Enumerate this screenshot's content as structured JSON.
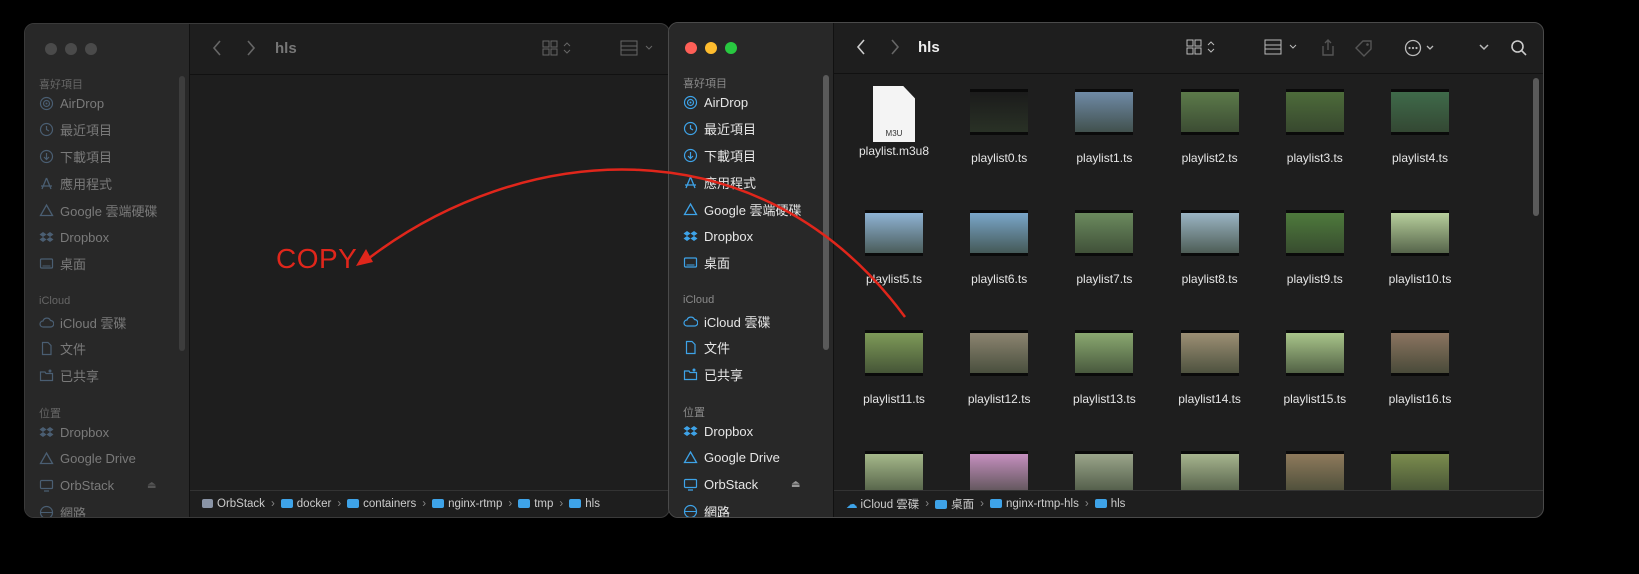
{
  "left_window": {
    "title": "hls",
    "sidebar": {
      "favorites_header": "喜好項目",
      "favorites": [
        {
          "label": "AirDrop",
          "icon": "airdrop-icon"
        },
        {
          "label": "最近項目",
          "icon": "clock-icon"
        },
        {
          "label": "下載項目",
          "icon": "download-icon"
        },
        {
          "label": "應用程式",
          "icon": "apps-icon"
        },
        {
          "label": "Google 雲端硬碟",
          "icon": "drive-icon"
        },
        {
          "label": "Dropbox",
          "icon": "dropbox-icon"
        },
        {
          "label": "桌面",
          "icon": "desktop-icon"
        }
      ],
      "icloud_header": "iCloud",
      "icloud": [
        {
          "label": "iCloud 雲碟",
          "icon": "cloud-icon"
        },
        {
          "label": "文件",
          "icon": "document-icon"
        },
        {
          "label": "已共享",
          "icon": "shared-folder-icon"
        }
      ],
      "locations_header": "位置",
      "locations": [
        {
          "label": "Dropbox",
          "icon": "dropbox-icon"
        },
        {
          "label": "Google Drive",
          "icon": "drive-icon"
        },
        {
          "label": "OrbStack",
          "icon": "display-icon"
        },
        {
          "label": "網路",
          "icon": "network-icon"
        }
      ]
    },
    "path": [
      "OrbStack",
      "docker",
      "containers",
      "nginx-rtmp",
      "tmp",
      "hls"
    ]
  },
  "right_window": {
    "title": "hls",
    "sidebar": {
      "favorites_header": "喜好項目",
      "favorites": [
        {
          "label": "AirDrop",
          "icon": "airdrop-icon"
        },
        {
          "label": "最近項目",
          "icon": "clock-icon"
        },
        {
          "label": "下載項目",
          "icon": "download-icon"
        },
        {
          "label": "應用程式",
          "icon": "apps-icon"
        },
        {
          "label": "Google 雲端硬碟",
          "icon": "drive-icon"
        },
        {
          "label": "Dropbox",
          "icon": "dropbox-icon"
        },
        {
          "label": "桌面",
          "icon": "desktop-icon"
        }
      ],
      "icloud_header": "iCloud",
      "icloud": [
        {
          "label": "iCloud 雲碟",
          "icon": "cloud-icon"
        },
        {
          "label": "文件",
          "icon": "document-icon"
        },
        {
          "label": "已共享",
          "icon": "shared-folder-icon"
        }
      ],
      "locations_header": "位置",
      "locations": [
        {
          "label": "Dropbox",
          "icon": "dropbox-icon"
        },
        {
          "label": "Google Drive",
          "icon": "drive-icon"
        },
        {
          "label": "OrbStack",
          "icon": "display-icon"
        },
        {
          "label": "網路",
          "icon": "network-icon"
        }
      ]
    },
    "files": [
      {
        "name": "playlist.m3u8",
        "kind": "m3u",
        "badge": "M3U"
      },
      {
        "name": "playlist0.ts",
        "kind": "video",
        "color": "#1b1b1b"
      },
      {
        "name": "playlist1.ts",
        "kind": "video",
        "color": "#6f8aa6"
      },
      {
        "name": "playlist2.ts",
        "kind": "video",
        "color": "#5c7a4a"
      },
      {
        "name": "playlist3.ts",
        "kind": "video",
        "color": "#4d6b3a"
      },
      {
        "name": "playlist4.ts",
        "kind": "video",
        "color": "#3f6a4a"
      },
      {
        "name": "playlist5.ts",
        "kind": "video",
        "color": "#8fb3d4"
      },
      {
        "name": "playlist6.ts",
        "kind": "video",
        "color": "#7aa6c9"
      },
      {
        "name": "playlist7.ts",
        "kind": "video",
        "color": "#6b8a5e"
      },
      {
        "name": "playlist8.ts",
        "kind": "video",
        "color": "#9bb5c4"
      },
      {
        "name": "playlist9.ts",
        "kind": "video",
        "color": "#4e7a3c"
      },
      {
        "name": "playlist10.ts",
        "kind": "video",
        "color": "#b7cf9c"
      },
      {
        "name": "playlist11.ts",
        "kind": "video",
        "color": "#7e9a58"
      },
      {
        "name": "playlist12.ts",
        "kind": "video",
        "color": "#8c8470"
      },
      {
        "name": "playlist13.ts",
        "kind": "video",
        "color": "#8aa870"
      },
      {
        "name": "playlist14.ts",
        "kind": "video",
        "color": "#9c8f74"
      },
      {
        "name": "playlist15.ts",
        "kind": "video",
        "color": "#a9c58a"
      },
      {
        "name": "playlist16.ts",
        "kind": "video",
        "color": "#8b7460"
      },
      {
        "name": "",
        "kind": "video",
        "color": "#a5b88a"
      },
      {
        "name": "",
        "kind": "video",
        "color": "#c58fbf"
      },
      {
        "name": "",
        "kind": "video",
        "color": "#9aa58a"
      },
      {
        "name": "",
        "kind": "video",
        "color": "#a6b48e"
      },
      {
        "name": "",
        "kind": "video",
        "color": "#8e7a5c"
      },
      {
        "name": "",
        "kind": "video",
        "color": "#7b8c4e"
      }
    ],
    "path": [
      {
        "label": "iCloud 雲碟",
        "icon": "cloud-icon"
      },
      {
        "label": "桌面",
        "icon": "folder-icon"
      },
      {
        "label": "nginx-rtmp-hls",
        "icon": "folder-icon"
      },
      {
        "label": "hls",
        "icon": "folder-icon"
      }
    ]
  },
  "annotation": {
    "text": "COPY",
    "color": "#e0261b"
  },
  "colors": {
    "accent": "#3ea3e8",
    "close": "#fe5f57",
    "minimize": "#febc2e",
    "zoom": "#28c840"
  }
}
